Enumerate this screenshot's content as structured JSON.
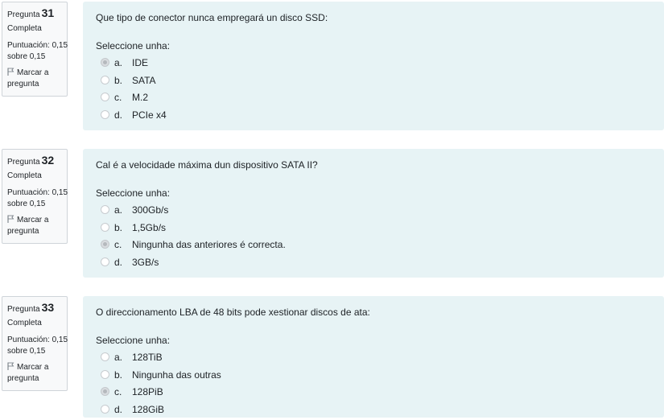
{
  "labels": {
    "question_prefix": "Pregunta",
    "prompt": "Seleccione unha:",
    "flag": "Marcar a pregunta"
  },
  "questions": [
    {
      "number": "31",
      "state": "Completa",
      "grade": "Puntuación: 0,15 sobre 0,15",
      "text": "Que tipo de conector nunca empregará un disco SSD:",
      "options": [
        {
          "letter": "a.",
          "text": "IDE",
          "selected": true
        },
        {
          "letter": "b.",
          "text": "SATA",
          "selected": false
        },
        {
          "letter": "c.",
          "text": "M.2",
          "selected": false
        },
        {
          "letter": "d.",
          "text": "PCIe x4",
          "selected": false
        }
      ]
    },
    {
      "number": "32",
      "state": "Completa",
      "grade": "Puntuación: 0,15 sobre 0,15",
      "text": "Cal é a velocidade máxima dun dispositivo SATA II?",
      "options": [
        {
          "letter": "a.",
          "text": "300Gb/s",
          "selected": false
        },
        {
          "letter": "b.",
          "text": "1,5Gb/s",
          "selected": false
        },
        {
          "letter": "c.",
          "text": "Ningunha das anteriores é correcta.",
          "selected": true
        },
        {
          "letter": "d.",
          "text": "3GB/s",
          "selected": false
        }
      ]
    },
    {
      "number": "33",
      "state": "Completa",
      "grade": "Puntuación: 0,15 sobre 0,15",
      "text": "O direccionamento LBA de 48 bits pode xestionar discos de ata:",
      "options": [
        {
          "letter": "a.",
          "text": "128TiB",
          "selected": false
        },
        {
          "letter": "b.",
          "text": "Ningunha das outras",
          "selected": false
        },
        {
          "letter": "c.",
          "text": "128PiB",
          "selected": true
        },
        {
          "letter": "d.",
          "text": "128GiB",
          "selected": false
        }
      ]
    }
  ]
}
